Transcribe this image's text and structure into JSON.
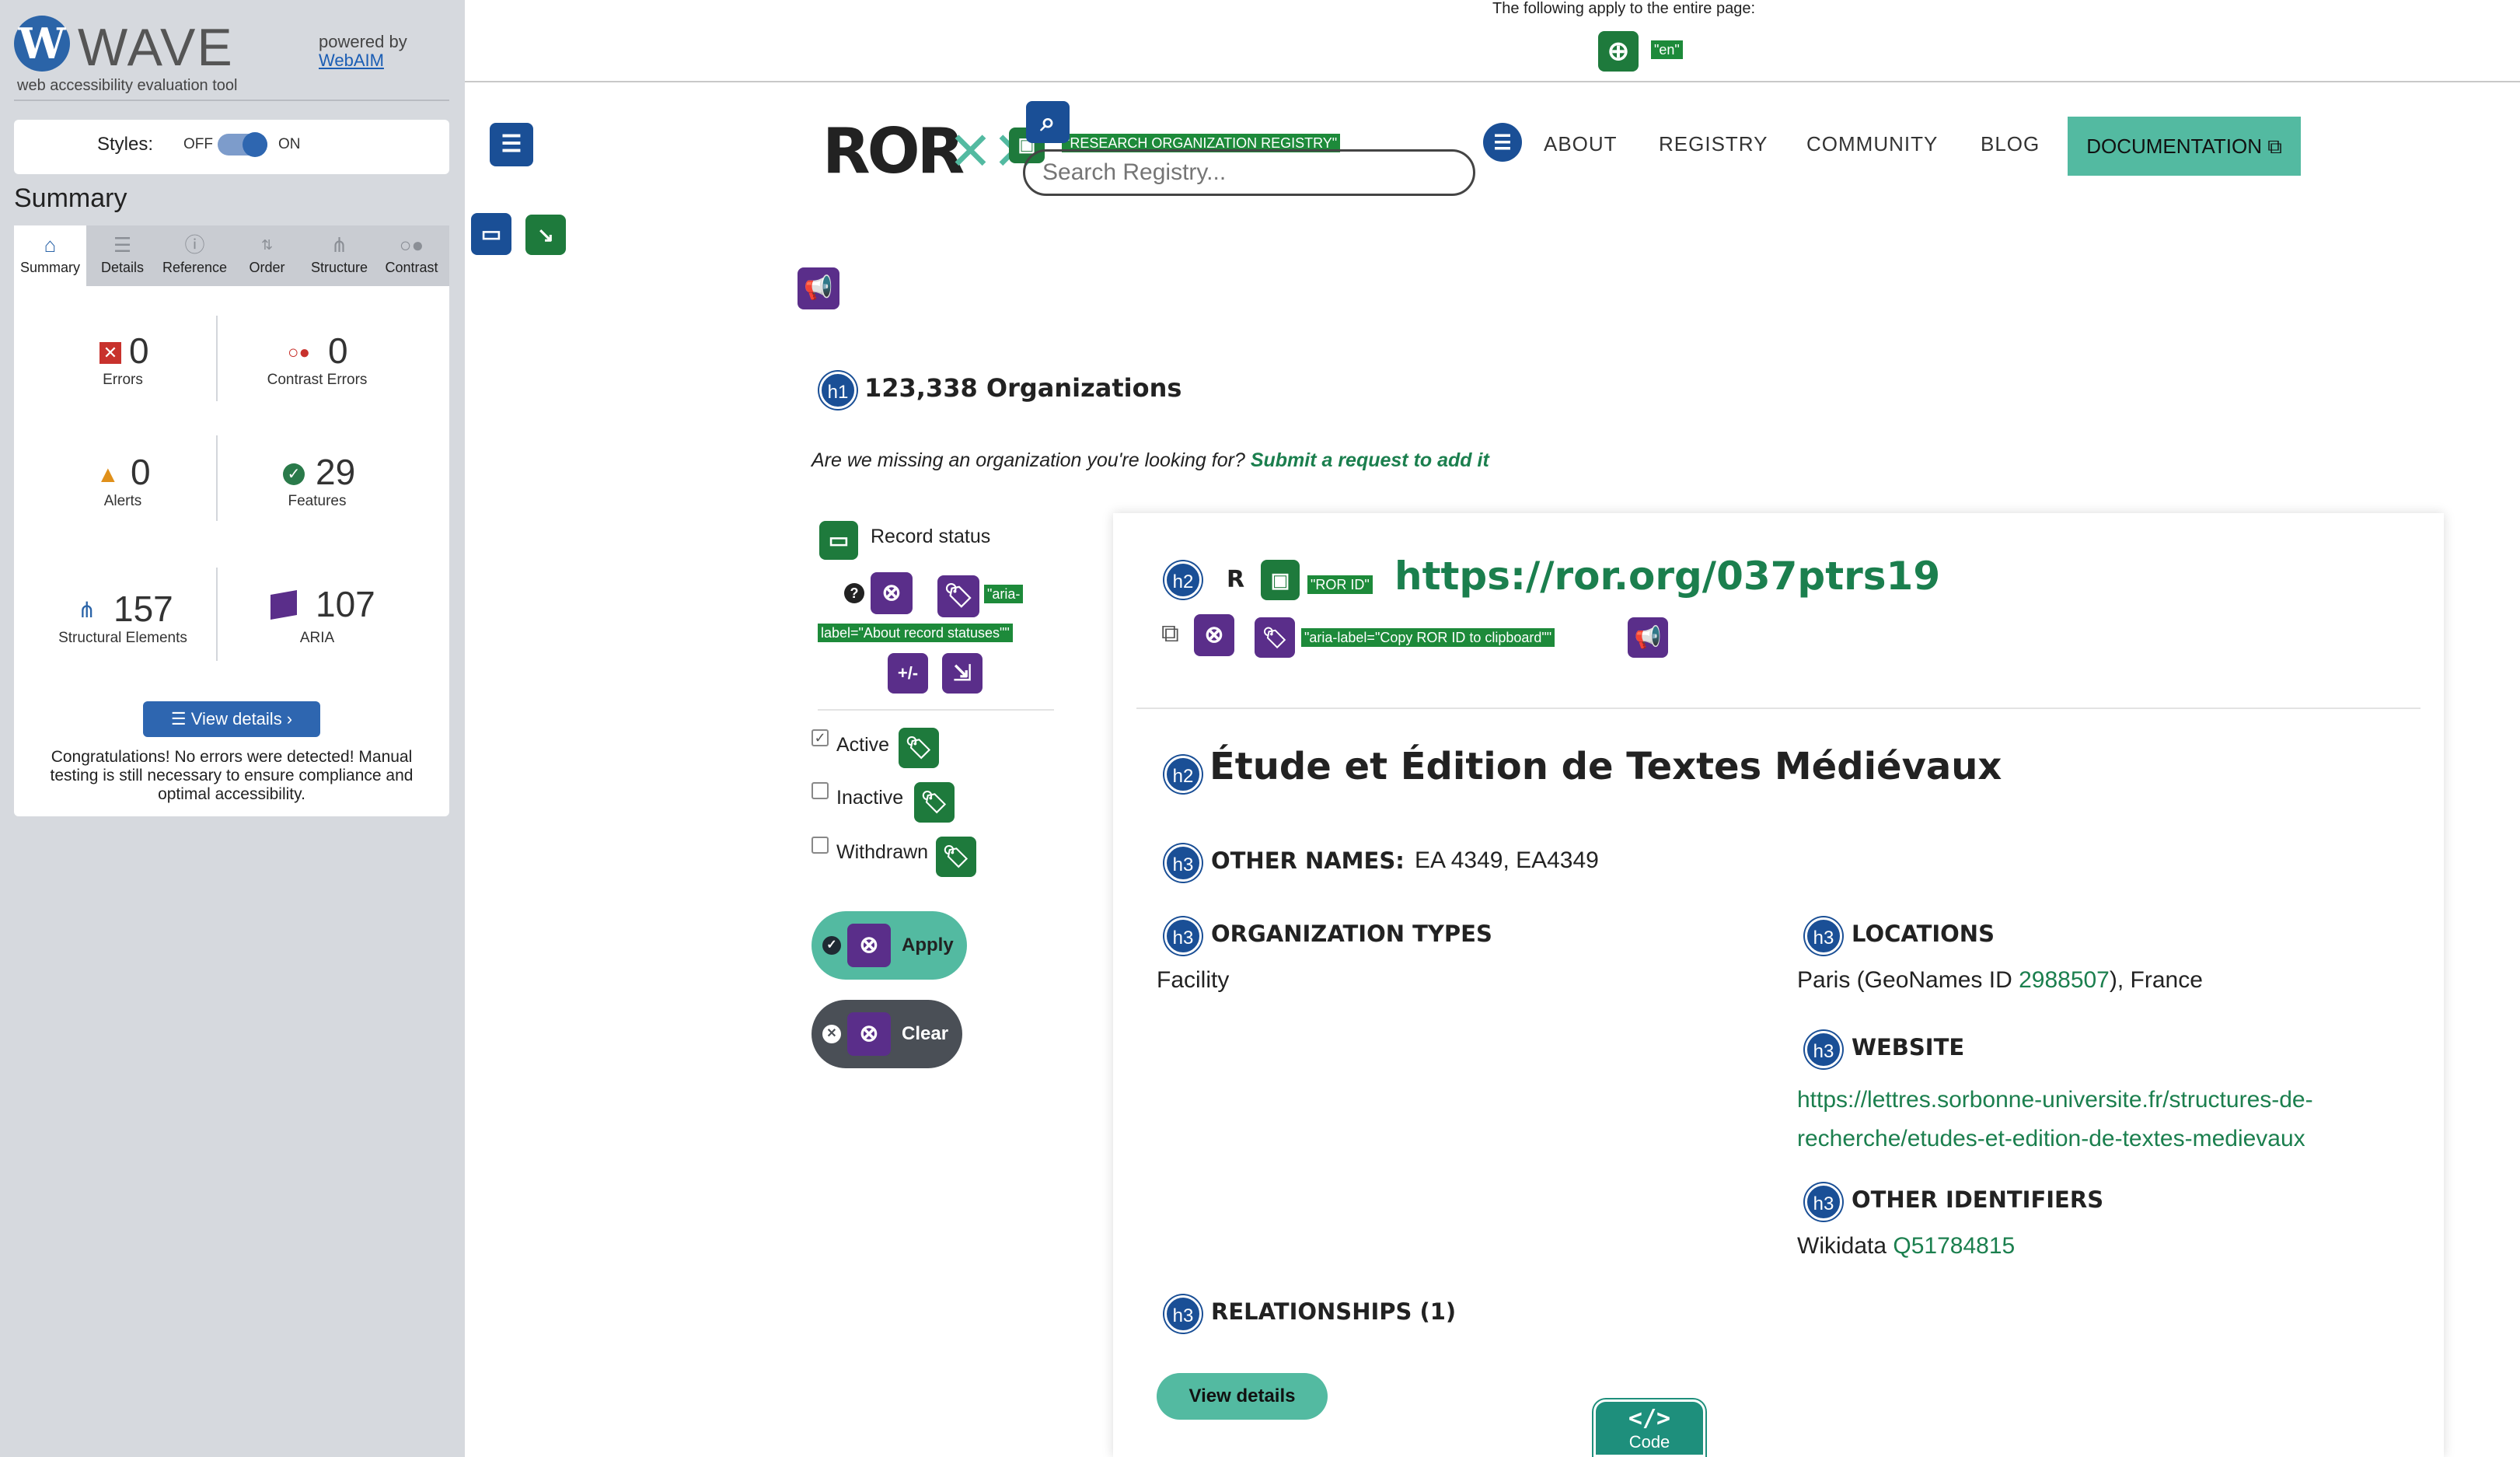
{
  "wave": {
    "logo_letter": "W",
    "title": "WAVE",
    "subtitle": "web accessibility evaluation tool",
    "powered_by": "powered by",
    "powered_link": "WebAIM",
    "styles_label": "Styles:",
    "styles_off": "OFF",
    "styles_on": "ON",
    "summary_heading": "Summary",
    "tabs": [
      {
        "label": "Summary",
        "icon": "home-icon"
      },
      {
        "label": "Details",
        "icon": "list-icon"
      },
      {
        "label": "Reference",
        "icon": "info-icon"
      },
      {
        "label": "Order",
        "icon": "order-icon"
      },
      {
        "label": "Structure",
        "icon": "structure-icon"
      },
      {
        "label": "Contrast",
        "icon": "contrast-icon"
      }
    ],
    "stats": {
      "errors": {
        "value": "0",
        "label": "Errors"
      },
      "contrast_errors": {
        "value": "0",
        "label": "Contrast Errors"
      },
      "alerts": {
        "value": "0",
        "label": "Alerts"
      },
      "features": {
        "value": "29",
        "label": "Features"
      },
      "structural": {
        "value": "157",
        "label": "Structural Elements"
      },
      "aria": {
        "value": "107",
        "label": "ARIA"
      }
    },
    "view_details": "View details ›",
    "congrats": "Congratulations! No errors were detected! Manual testing is still necessary to ensure compliance and optimal accessibility."
  },
  "page_notice": {
    "text": "The following apply to the entire page:",
    "lang": "\"en\""
  },
  "header": {
    "logo": "ROR",
    "logo_mark": "✕✕",
    "registry_label": "\"RESEARCH ORGANIZATION REGISTRY\"",
    "search_placeholder": "Search Registry...",
    "nav": [
      "ABOUT",
      "REGISTRY",
      "COMMUNITY",
      "BLOG"
    ],
    "documentation": "DOCUMENTATION"
  },
  "main": {
    "h1": "123,338 Organizations",
    "missing_prefix": "Are we missing an organization you're looking for?",
    "missing_link": "Submit a request to add it"
  },
  "filters": {
    "record_status": "Record status",
    "aria_label_line1": "\"aria-",
    "aria_label_line2": "label=\"About record statuses\"\"",
    "options": [
      {
        "label": "Active",
        "checked": true
      },
      {
        "label": "Inactive",
        "checked": false
      },
      {
        "label": "Withdrawn",
        "checked": false
      }
    ],
    "apply": "Apply",
    "clear": "Clear"
  },
  "record": {
    "ror_id_label": "\"ROR ID\"",
    "ror_url": "https://ror.org/037ptrs19",
    "copy_label": "\"aria-label=\"Copy ROR ID to clipboard\"\"",
    "name": "Étude et Édition de Textes Médiévaux",
    "other_names_heading": "OTHER NAMES:",
    "other_names": "EA 4349, EA4349",
    "org_types_heading": "ORGANIZATION TYPES",
    "org_type": "Facility",
    "locations_heading": "LOCATIONS",
    "location_prefix": "Paris (GeoNames ID ",
    "location_geonames": "2988507",
    "location_suffix": "), France",
    "website_heading": "WEBSITE",
    "website_line1": "https://lettres.sorbonne-universite.fr/structures-de-",
    "website_line2": "recherche/etudes-et-edition-de-textes-medievaux",
    "other_ids_heading": "OTHER IDENTIFIERS",
    "wikidata_prefix": "Wikidata ",
    "wikidata_id": "Q51784815",
    "relationships_heading": "RELATIONSHIPS (1)",
    "view_details": "View details"
  },
  "wave_badges": {
    "h1": "h1",
    "h2": "h2",
    "h3": "h3",
    "plus_minus": "+/-",
    "r": "R",
    "question": "?"
  },
  "code_tab": {
    "icon": "</>",
    "label": "Code"
  },
  "colors": {
    "wave_blue": "#1a4f96",
    "wave_green": "#1e7a3c",
    "wave_purple": "#5a2e8a",
    "ror_teal": "#53baa1",
    "link_green": "#1b7f4e"
  }
}
